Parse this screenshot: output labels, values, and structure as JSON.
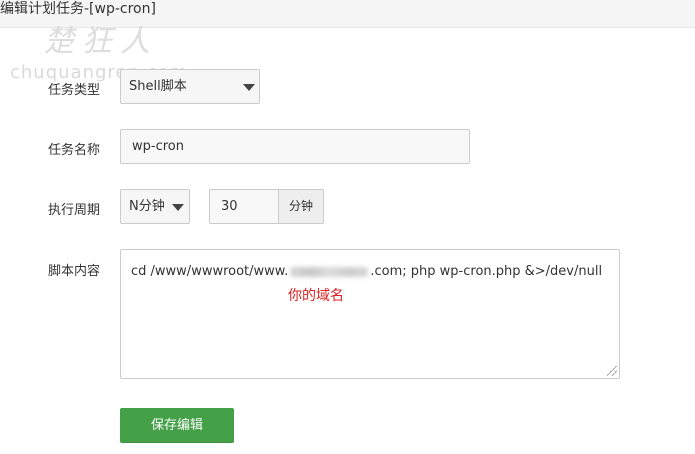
{
  "window": {
    "title": "编辑计划任务-[wp-cron]"
  },
  "watermark": {
    "chinese": "楚狂人",
    "url": "chuquangren.com"
  },
  "form": {
    "task_type": {
      "label": "任务类型",
      "value": "Shell脚本"
    },
    "task_name": {
      "label": "任务名称",
      "value": "wp-cron"
    },
    "period": {
      "label": "执行周期",
      "unit_select": "N分钟",
      "interval_value": "30",
      "interval_unit": "分钟"
    },
    "script": {
      "label": "脚本内容",
      "prefix": "cd /www/wwwroot/www.",
      "suffix": ".com; php wp-cron.php &>/dev/null"
    },
    "annotation": "你的域名",
    "save_label": "保存编辑"
  },
  "colors": {
    "accent": "#43a047",
    "annotation": "#e02020"
  }
}
